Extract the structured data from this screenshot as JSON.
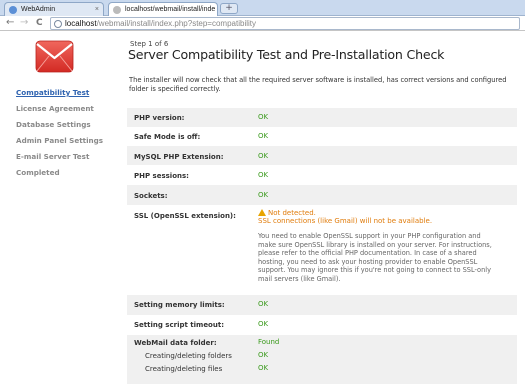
{
  "browser": {
    "tabs": [
      {
        "title": "WebAdmin",
        "active": false
      },
      {
        "title": "localhost/webmail/install/inde",
        "active": true
      }
    ],
    "new_tab_symbol": "+",
    "close_symbol": "×",
    "back_symbol": "←",
    "forward_symbol": "→",
    "reload_symbol": "C",
    "url_host": "localhost",
    "url_path": "/webmail/install/index.php?step=compatibility"
  },
  "header": {
    "step": "Step 1 of 6",
    "title": "Server Compatibility Test and Pre-Installation Check",
    "intro": "The installer will now check that all the required server software is installed, has correct versions and configured folder is specified correctly."
  },
  "sidebar": {
    "items": [
      {
        "label": "Compatibility Test",
        "active": true
      },
      {
        "label": "License Agreement",
        "active": false
      },
      {
        "label": "Database Settings",
        "active": false
      },
      {
        "label": "Admin Panel Settings",
        "active": false
      },
      {
        "label": "E-mail Server Test",
        "active": false
      },
      {
        "label": "Completed",
        "active": false
      }
    ]
  },
  "checks": [
    {
      "label": "PHP version:",
      "status": "OK"
    },
    {
      "label": "Safe Mode is off:",
      "status": "OK"
    },
    {
      "label": "MySQL PHP Extension:",
      "status": "OK"
    },
    {
      "label": "PHP sessions:",
      "status": "OK"
    },
    {
      "label": "Sockets:",
      "status": "OK"
    },
    {
      "label": "SSL (OpenSSL extension):",
      "status": "Not detected."
    },
    {
      "label": "Setting memory limits:",
      "status": "OK"
    },
    {
      "label": "Setting script timeout:",
      "status": "OK"
    },
    {
      "label": "WebMail data folder:",
      "status": "Found"
    },
    {
      "label": "Creating/deleting folders",
      "status": "OK"
    },
    {
      "label": "Creating/deleting files",
      "status": "OK"
    }
  ],
  "ssl_warning": {
    "headline": "Not detected.",
    "subline": "SSL connections (like Gmail) will not be available.",
    "detail": "You need to enable OpenSSL support in your PHP configuration and make sure OpenSSL library is installed on your server. For instructions, please refer to the official PHP documentation. In case of a shared hosting, you need to ask your hosting provider to enable OpenSSL support. You may ignore this if you're not going to connect to SSL-only mail servers (like Gmail)."
  },
  "colors": {
    "ok": "#3a9a1c",
    "warning": "#e07c0c",
    "active_link": "#2f63b0",
    "logo": "#e8413a"
  },
  "icons": {
    "logo": "envelope-icon",
    "warning": "warning-triangle-icon",
    "globe": "globe-icon"
  }
}
